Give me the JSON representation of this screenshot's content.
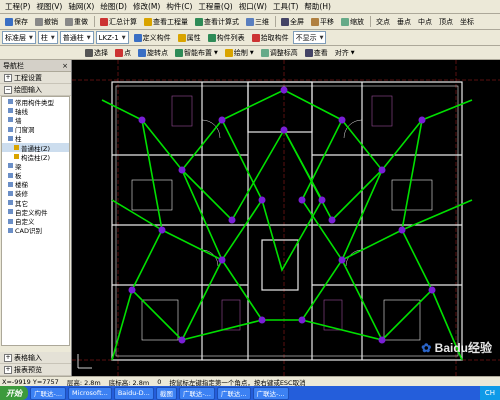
{
  "menu": [
    "工程(P)",
    "视图(V)",
    "轴网(X)",
    "绘图(D)",
    "修改(M)",
    "构件(C)",
    "工程量(Q)",
    "视口(W)",
    "工具(T)",
    "帮助(H)"
  ],
  "toolbar1": {
    "save": "保存",
    "undo": "撤销",
    "redo": "重做",
    "calc": "汇总计算",
    "view_calc": "查看工程量",
    "view_formula": "查看计算式",
    "three_d": "三维",
    "full_screen": "全屏",
    "pan": "平移",
    "zoom": "缩放",
    "snap1": "交点",
    "snap2": "垂点",
    "snap3": "中点",
    "snap4": "顶点",
    "snap5": "坐标"
  },
  "toolbar2": {
    "combo_layer": "标准层",
    "combo_type": "柱",
    "combo_sub": "普通柱",
    "combo_name": "LKZ-1",
    "btn_define": "定义构件",
    "btn_attr": "属性",
    "btn_list": "构件列表",
    "btn_pick": "拾取构件",
    "btn_nodisplay": "不显示"
  },
  "toolbar3": {
    "select": "选择",
    "point": "点",
    "rotate": "旋转点",
    "smart": "智能布置",
    "draw": "绘制",
    "adjust": "调整标高",
    "query": "查看",
    "align": "对齐"
  },
  "nav": {
    "title": "导航栏",
    "sections": [
      "工程设置",
      "绘图输入"
    ],
    "tree": [
      "常用构件类型",
      "轴线",
      "墙",
      "门窗洞",
      "柱",
      "普通柱(Z)",
      "构造柱(Z)",
      "梁",
      "板",
      "楼梯",
      "装修",
      "其它",
      "自定义构件",
      "自定义",
      "CAD识别"
    ],
    "bottom": [
      "表格输入",
      "报表预览"
    ]
  },
  "status": {
    "coords": "X=-9919  Y=7757",
    "floor_height": "层高: 2.8m",
    "floor_base": "底标高: 2.8m",
    "offset": "0",
    "hint": "按鼠标左键指定第一个角点，按右键或ESC取消"
  },
  "taskbar": {
    "start": "开始",
    "tasks": [
      "广联达-...",
      "Microsoft...",
      "Baidu-D...",
      "截图",
      "广联达-...",
      "广联达...",
      "广联达-..."
    ],
    "clock": "CH"
  },
  "colors": {
    "canvas_bg": "#000000",
    "wall_lines": "#e8e8e8",
    "wiring": "#00e000",
    "nodes": "#7a1fd6",
    "axis": "#ff3030"
  },
  "watermark": "Baidu经验"
}
